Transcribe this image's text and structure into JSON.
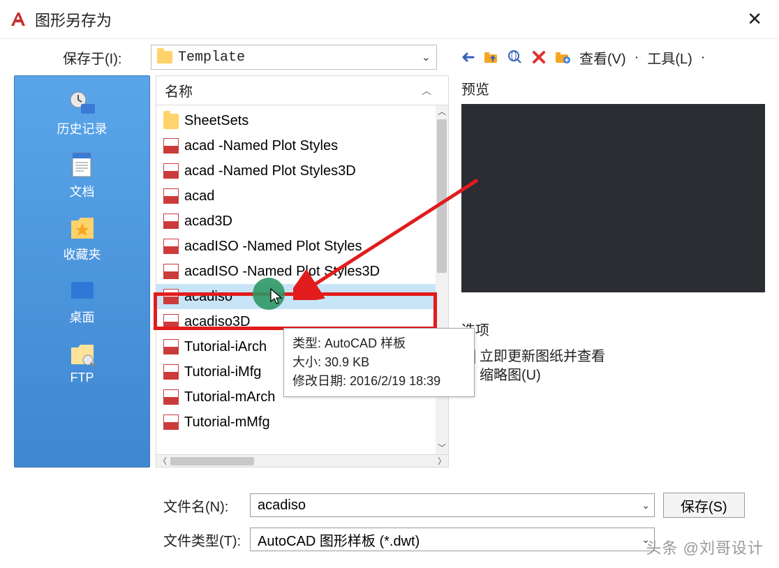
{
  "title": "图形另存为",
  "save_in_label": "保存于(I):",
  "current_path": "Template",
  "toolbar_text": {
    "view": "查看(V)",
    "tools": "工具(L)"
  },
  "sidebar": [
    {
      "label": "历史记录",
      "name": "sidebar-history"
    },
    {
      "label": "文档",
      "name": "sidebar-documents"
    },
    {
      "label": "收藏夹",
      "name": "sidebar-favorites"
    },
    {
      "label": "桌面",
      "name": "sidebar-desktop"
    },
    {
      "label": "FTP",
      "name": "sidebar-ftp"
    }
  ],
  "column_header": "名称",
  "files": [
    {
      "name": "SheetSets",
      "type": "folder"
    },
    {
      "name": "acad -Named Plot Styles",
      "type": "dwt"
    },
    {
      "name": "acad -Named Plot Styles3D",
      "type": "dwt"
    },
    {
      "name": "acad",
      "type": "dwt"
    },
    {
      "name": "acad3D",
      "type": "dwt"
    },
    {
      "name": "acadISO -Named Plot Styles",
      "type": "dwt"
    },
    {
      "name": "acadISO -Named Plot Styles3D",
      "type": "dwt"
    },
    {
      "name": "acadiso",
      "type": "dwt",
      "selected": true
    },
    {
      "name": "acadiso3D",
      "type": "dwt"
    },
    {
      "name": "Tutorial-iArch",
      "type": "dwt"
    },
    {
      "name": "Tutorial-iMfg",
      "type": "dwt"
    },
    {
      "name": "Tutorial-mArch",
      "type": "dwt"
    },
    {
      "name": "Tutorial-mMfg",
      "type": "dwt"
    }
  ],
  "tooltip": {
    "type_label": "类型:",
    "type_val": "AutoCAD 样板",
    "size_label": "大小:",
    "size_val": "30.9 KB",
    "date_label": "修改日期:",
    "date_val": "2016/2/19 18:39"
  },
  "preview_label": "预览",
  "options_label": "选项",
  "option_update": "立即更新图纸并查看\n缩略图(U)",
  "filename_label": "文件名(N):",
  "filename_value": "acadiso",
  "filetype_label": "文件类型(T):",
  "filetype_value": "AutoCAD 图形样板 (*.dwt)",
  "save_btn": "保存(S)",
  "watermark": "头条 @刘哥设计"
}
